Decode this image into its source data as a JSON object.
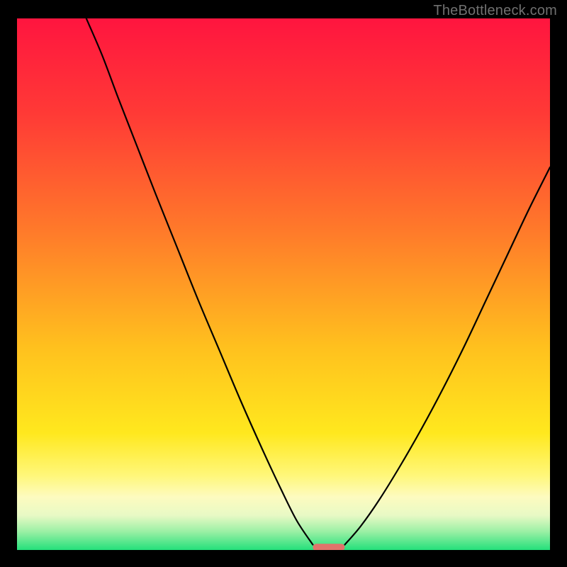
{
  "watermark": "TheBottleneck.com",
  "chart_data": {
    "type": "line",
    "title": "",
    "xlabel": "",
    "ylabel": "",
    "xlim": [
      0,
      100
    ],
    "ylim": [
      0,
      100
    ],
    "background_gradient_stops": [
      {
        "offset": 0.0,
        "color": "#ff153f"
      },
      {
        "offset": 0.18,
        "color": "#ff3a36"
      },
      {
        "offset": 0.4,
        "color": "#ff7a2a"
      },
      {
        "offset": 0.62,
        "color": "#ffc11e"
      },
      {
        "offset": 0.78,
        "color": "#ffe81e"
      },
      {
        "offset": 0.86,
        "color": "#fff77a"
      },
      {
        "offset": 0.9,
        "color": "#fdfbbf"
      },
      {
        "offset": 0.935,
        "color": "#e8f9c5"
      },
      {
        "offset": 0.965,
        "color": "#9cf0a5"
      },
      {
        "offset": 1.0,
        "color": "#24e07b"
      }
    ],
    "series": [
      {
        "name": "left-branch",
        "x": [
          13.0,
          16.0,
          19.0,
          22.5,
          26.0,
          30.0,
          34.0,
          38.0,
          42.0,
          46.0,
          49.5,
          52.5,
          55.5
        ],
        "values": [
          100.0,
          93.0,
          85.0,
          76.0,
          67.0,
          57.0,
          47.0,
          37.5,
          28.0,
          19.0,
          11.5,
          5.5,
          1.0
        ]
      },
      {
        "name": "right-branch",
        "x": [
          61.5,
          64.5,
          68.0,
          72.0,
          76.0,
          80.0,
          84.0,
          88.0,
          92.0,
          96.0,
          100.0
        ],
        "values": [
          1.0,
          4.5,
          9.5,
          16.0,
          23.0,
          30.5,
          38.5,
          47.0,
          55.5,
          64.0,
          72.0
        ]
      }
    ],
    "trough_marker": {
      "x_start": 55.5,
      "x_end": 61.5,
      "y": 0.5,
      "color": "#e0736b"
    },
    "colors": {
      "curve": "#000000",
      "frame": "#000000",
      "marker": "#e0736b"
    }
  }
}
